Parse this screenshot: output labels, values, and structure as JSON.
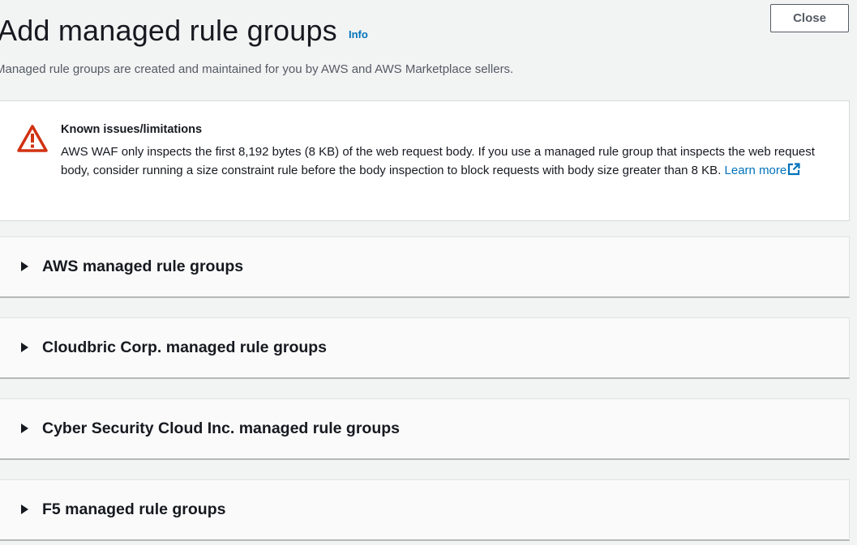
{
  "header": {
    "title": "Add managed rule groups",
    "info_label": "Info",
    "close_label": "Close",
    "description": "Managed rule groups are created and maintained for you by AWS and AWS Marketplace sellers."
  },
  "alert": {
    "icon": "warning-icon",
    "heading": "Known issues/limitations",
    "body": "AWS WAF only inspects the first 8,192 bytes (8 KB) of the web request body. If you use a managed rule group that inspects the web request body, consider running a size constraint rule before the body inspection to block requests with body size greater than 8 KB.",
    "link_label": "Learn more",
    "link_icon": "external-link-icon"
  },
  "sections": [
    {
      "label": "AWS managed rule groups",
      "expanded": false
    },
    {
      "label": "Cloudbric Corp. managed rule groups",
      "expanded": false
    },
    {
      "label": "Cyber Security Cloud Inc. managed rule groups",
      "expanded": false
    },
    {
      "label": "F5 managed rule groups",
      "expanded": false
    }
  ],
  "colors": {
    "page_background": "#f2f3f3",
    "link": "#0073bb",
    "warning": "#d13212",
    "text": "#16191f"
  }
}
